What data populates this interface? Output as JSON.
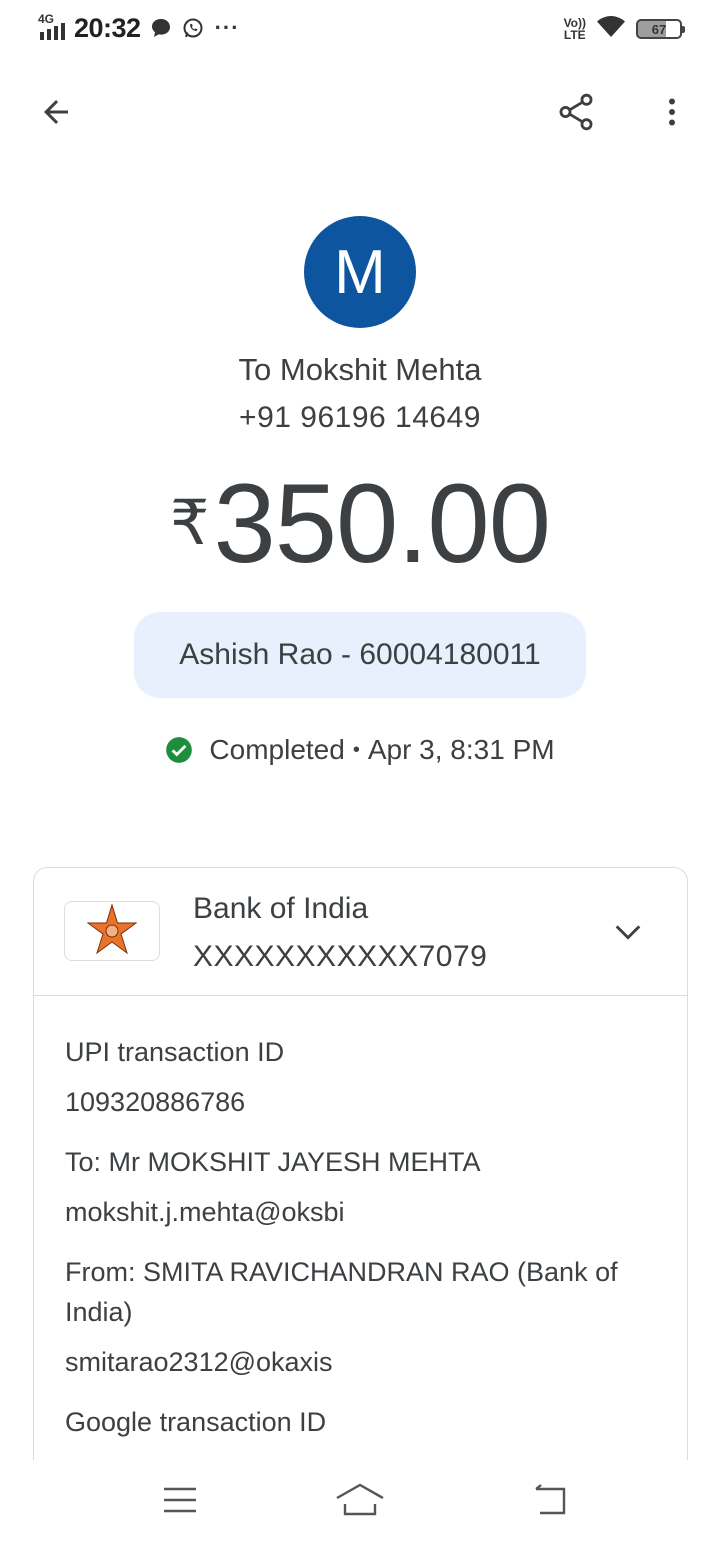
{
  "status_bar": {
    "network": "4G",
    "time": "20:32",
    "more": "···",
    "volte_top": "Vo))",
    "volte_bottom": "LTE",
    "battery": "67"
  },
  "recipient": {
    "initial": "M",
    "name_line": "To Mokshit Mehta",
    "phone": "+91 96196 14649"
  },
  "amount": {
    "currency": "₹",
    "value": "350.00"
  },
  "payer_chip": "Ashish Rao - 60004180011",
  "status": {
    "text": "Completed",
    "separator": "•",
    "date": "Apr 3, 8:31 PM",
    "color": "#1e8e3e"
  },
  "bank": {
    "name": "Bank of India",
    "account": "XXXXXXXXXXX7079"
  },
  "details": {
    "upi_label": "UPI transaction ID",
    "upi_value": "109320886786",
    "to_label": "To: Mr MOKSHIT JAYESH MEHTA",
    "to_value": "mokshit.j.mehta@oksbi",
    "from_label": "From: SMITA RAVICHANDRAN RAO (Bank of India)",
    "from_value": "smitarao2312@okaxis",
    "google_label": "Google transaction ID"
  },
  "colors": {
    "avatar": "#0d559f",
    "chip": "#e8f0fd",
    "text": "#3c4043"
  },
  "icons": {
    "back": "arrow-left-icon",
    "share": "share-icon",
    "more": "more-vert-icon",
    "expand": "chevron-down-icon",
    "nav_menu": "menu-icon",
    "nav_home": "home-icon",
    "nav_back": "back-nav-icon"
  }
}
